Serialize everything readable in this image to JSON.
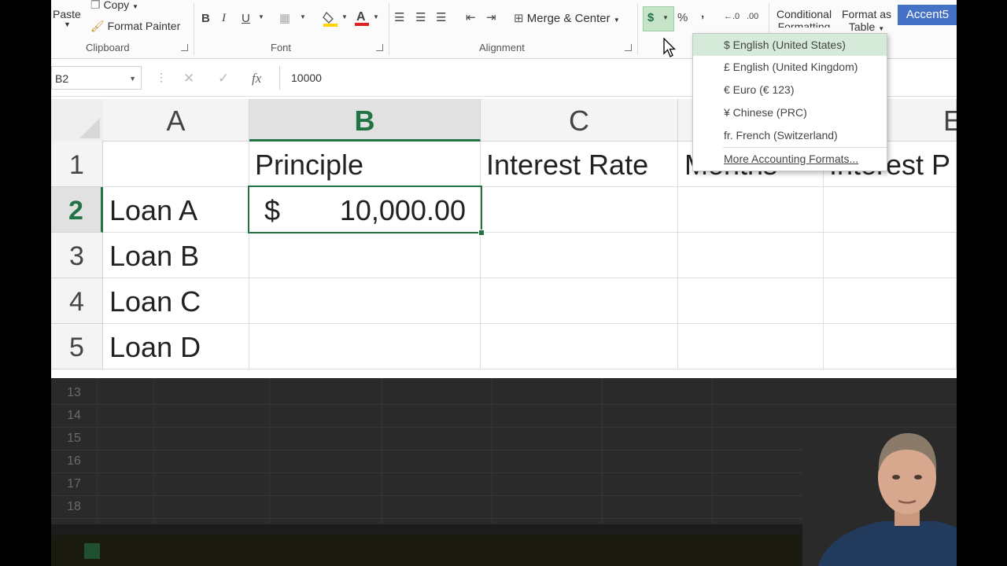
{
  "ribbon": {
    "clipboard": {
      "paste_label": "Paste",
      "copy_label": "Copy",
      "format_painter_label": "Format Painter",
      "group_label": "Clipboard"
    },
    "font": {
      "group_label": "Font",
      "bold": "B",
      "italic": "I",
      "underline": "U"
    },
    "alignment": {
      "group_label": "Alignment",
      "merge_center_label": "Merge & Center"
    },
    "number": {
      "currency_symbol": "$",
      "percent_symbol": "%",
      "comma_symbol": ","
    },
    "styles": {
      "conditional_formatting_label": "Conditional",
      "conditional_formatting_label2": "Formatting",
      "format_as_table_label": "Format as",
      "format_as_table_label2": "Table",
      "accent_label": "Accent5"
    }
  },
  "formula_bar": {
    "name_box": "B2",
    "fx": "fx",
    "value": "10000"
  },
  "sheet": {
    "columns": [
      "A",
      "B",
      "C",
      "",
      "E"
    ],
    "selected_column": "B",
    "rows": [
      {
        "num": "1",
        "a": "",
        "b": "Principle",
        "c": "Interest Rate",
        "d": "Months",
        "e": "Interest P"
      },
      {
        "num": "2",
        "a": "Loan A",
        "b_symbol": "$",
        "b_value": "10,000.00",
        "c": "",
        "d": "",
        "e": ""
      },
      {
        "num": "3",
        "a": "Loan B"
      },
      {
        "num": "4",
        "a": "Loan C"
      },
      {
        "num": "5",
        "a": "Loan D"
      }
    ],
    "dim_rows": [
      "13",
      "14",
      "15",
      "16",
      "17",
      "18"
    ]
  },
  "accounting_menu": {
    "items": [
      {
        "label": "$ English (United States)"
      },
      {
        "label": "£ English (United Kingdom)"
      },
      {
        "label": "€ Euro (€ 123)"
      },
      {
        "label": "¥ Chinese (PRC)"
      },
      {
        "label": "fr. French (Switzerland)"
      }
    ],
    "more_label": "More Accounting Formats..."
  },
  "colors": {
    "excel_green": "#217346",
    "accent5": "#4472c4",
    "menu_highlight": "#d5ead9"
  },
  "icons": [
    "paste-icon",
    "copy-icon",
    "format-painter-icon",
    "borders-icon",
    "fill-color-icon",
    "font-color-icon",
    "align-left-icon",
    "align-center-icon",
    "align-right-icon",
    "decrease-indent-icon",
    "increase-indent-icon",
    "merge-center-icon",
    "currency-icon",
    "percent-icon",
    "comma-icon",
    "increase-decimal-icon",
    "decrease-decimal-icon",
    "cancel-icon",
    "enter-icon",
    "mouse-cursor-icon"
  ]
}
